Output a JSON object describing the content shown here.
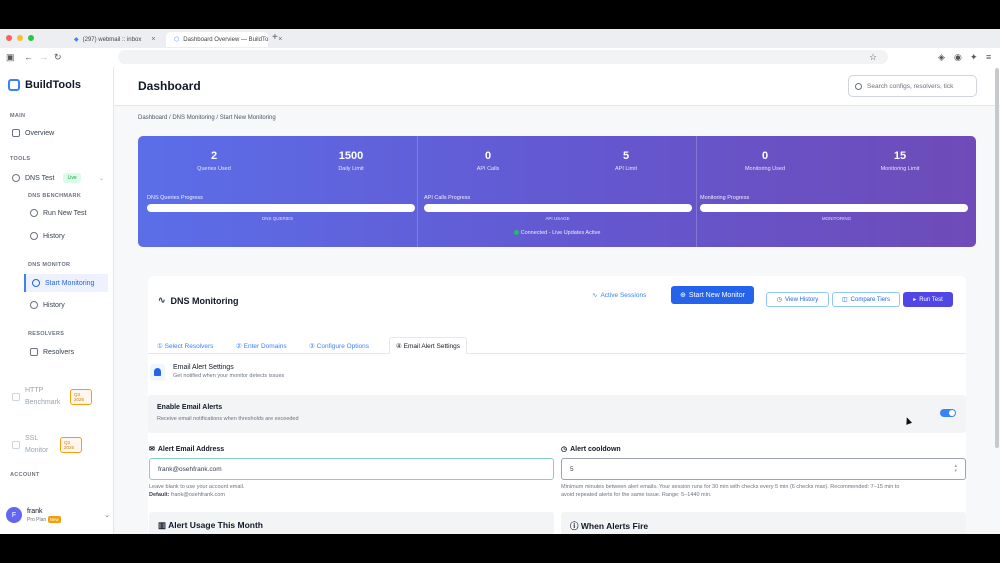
{
  "browser": {
    "tabs": [
      {
        "label": "(297) webmail :: inbox"
      },
      {
        "label": "Dashboard Overview — BuildTo"
      }
    ]
  },
  "sidebar": {
    "brand": "BuildTools",
    "sections": {
      "main": "MAIN",
      "tools": "TOOLS",
      "dns_benchmark": "DNS BENCHMARK",
      "dns_monitor": "DNS MONITOR",
      "resolvers": "RESOLVERS",
      "account": "ACCOUNT"
    },
    "items": {
      "overview": "Overview",
      "dns_test": "DNS Test",
      "live_badge": "Live",
      "run_new_test": "Run New Test",
      "history_bench": "History",
      "start_monitoring": "Start Monitoring",
      "history_monitor": "History",
      "resolvers": "Resolvers",
      "http_benchmark": "HTTP Benchmark",
      "http_soon": "Q3 2026",
      "ssl_monitor": "SSL Monitor",
      "ssl_soon": "Q3 2026"
    },
    "user": {
      "initial": "F",
      "name": "frank",
      "plan": "Pro Plan",
      "plan_tag": "New"
    }
  },
  "header": {
    "title": "Dashboard",
    "search_placeholder": "Search configs, resolvers, tick"
  },
  "breadcrumb": "Dashboard  /  DNS Monitoring  /  Start New Monitoring",
  "stats": {
    "groups": [
      {
        "used": "2",
        "used_label": "Queries Used",
        "limit": "1500",
        "limit_label": "Daily Limit",
        "progress_label": "DNS Queries Progress",
        "caption": "DNS QUERIES",
        "progress": 0.01
      },
      {
        "used": "0",
        "used_label": "API Calls",
        "limit": "5",
        "limit_label": "API Limit",
        "progress_label": "API Calls Progress",
        "caption": "API USAGE",
        "progress": 0.0
      },
      {
        "used": "0",
        "used_label": "Monitoring Used",
        "limit": "15",
        "limit_label": "Monitoring Limit",
        "progress_label": "Monitoring Progress",
        "caption": "MONITORING",
        "progress": 0.0
      }
    ],
    "connection": "Connected - Live Updates Active"
  },
  "monitor": {
    "title": "DNS Monitoring",
    "active_sessions": "Active Sessions",
    "start_new": "Start New Monitor",
    "view_history": "View History",
    "compare_tiers": "Compare Tiers",
    "run_test": "Run Test",
    "tabs": [
      "① Select Resolvers",
      "② Enter Domains",
      "③ Configure Options",
      "④ Email Alert Settings"
    ],
    "alert_title": "Email Alert Settings",
    "alert_subtitle": "Get notified when your monitor detects issues",
    "enable_title": "Enable Email Alerts",
    "enable_desc": "Receive email notifications when thresholds are exceeded",
    "email_label": "Alert Email Address",
    "email_value": "frank@osehfrank.com",
    "email_help": "Leave blank to use your account email.",
    "email_default_label": "Default:",
    "email_default_value": "frank@osehfrank.com",
    "cooldown_label": "Alert cooldown",
    "cooldown_value": "5",
    "cooldown_help_1": "Minimum minutes between alert emails. Your session runs for 30 min with checks every 5 min (6 checks max). Recommended: 7–15 min to",
    "cooldown_help_2": "avoid repeated alerts for the same issue. Range: 5–1440 min.",
    "usage_title": "Alert Usage This Month",
    "when_title": "When Alerts Fire"
  }
}
